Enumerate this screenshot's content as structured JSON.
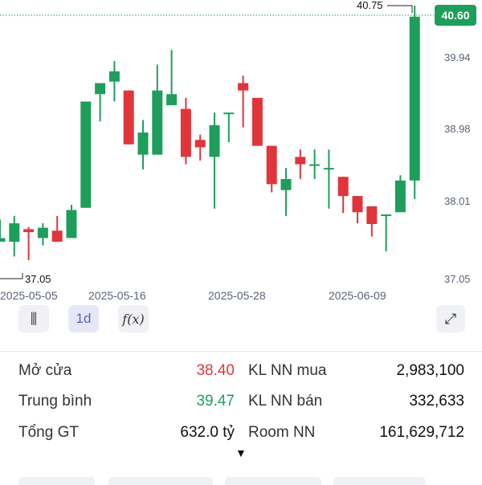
{
  "colors": {
    "up": "#1e9e5c",
    "down": "#e0353b",
    "axis_text": "#5a6275",
    "current_badge": "#1e9e5c"
  },
  "chart_data": {
    "type": "candlestick",
    "price_labels": [
      "39.94",
      "38.98",
      "38.01",
      "37.05"
    ],
    "price_ticks": [
      39.94,
      38.98,
      38.01,
      37.05
    ],
    "date_labels": [
      "2025-05-05",
      "2025-05-16",
      "2025-05-28",
      "2025-06-09"
    ],
    "high_marker": "40.75",
    "low_marker": "37.05",
    "current_price": "40.60",
    "ylim": [
      37.05,
      40.75
    ],
    "candles": [
      {
        "o": 37.55,
        "h": 37.85,
        "l": 37.55,
        "c": 37.6
      },
      {
        "o": 37.55,
        "h": 37.9,
        "l": 37.35,
        "c": 37.8
      },
      {
        "o": 37.72,
        "h": 37.75,
        "l": 37.3,
        "c": 37.68
      },
      {
        "o": 37.6,
        "h": 37.8,
        "l": 37.5,
        "c": 37.74
      },
      {
        "o": 37.7,
        "h": 37.9,
        "l": 37.55,
        "c": 37.55
      },
      {
        "o": 37.6,
        "h": 38.05,
        "l": 37.6,
        "c": 37.98
      },
      {
        "o": 38.01,
        "h": 39.45,
        "l": 38.01,
        "c": 39.45
      },
      {
        "o": 39.55,
        "h": 39.7,
        "l": 39.18,
        "c": 39.7
      },
      {
        "o": 39.72,
        "h": 40.0,
        "l": 39.45,
        "c": 39.86
      },
      {
        "o": 39.6,
        "h": 39.6,
        "l": 38.87,
        "c": 38.87
      },
      {
        "o": 38.73,
        "h": 39.2,
        "l": 38.53,
        "c": 39.03
      },
      {
        "o": 38.73,
        "h": 39.95,
        "l": 38.73,
        "c": 39.6
      },
      {
        "o": 39.4,
        "h": 40.15,
        "l": 39.4,
        "c": 39.55
      },
      {
        "o": 39.35,
        "h": 39.5,
        "l": 38.6,
        "c": 38.7
      },
      {
        "o": 38.93,
        "h": 39.0,
        "l": 38.65,
        "c": 38.83
      },
      {
        "o": 38.7,
        "h": 39.3,
        "l": 38.0,
        "c": 39.13
      },
      {
        "o": 39.3,
        "h": 39.3,
        "l": 38.9,
        "c": 39.3
      },
      {
        "o": 39.7,
        "h": 39.8,
        "l": 39.1,
        "c": 39.6
      },
      {
        "o": 39.5,
        "h": 39.5,
        "l": 38.85,
        "c": 38.85
      },
      {
        "o": 38.85,
        "h": 38.85,
        "l": 38.22,
        "c": 38.33
      },
      {
        "o": 38.25,
        "h": 38.55,
        "l": 37.9,
        "c": 38.4
      },
      {
        "o": 38.7,
        "h": 38.8,
        "l": 38.4,
        "c": 38.6
      },
      {
        "o": 38.6,
        "h": 38.8,
        "l": 38.4,
        "c": 38.6
      },
      {
        "o": 38.55,
        "h": 38.8,
        "l": 38.0,
        "c": 38.55
      },
      {
        "o": 38.43,
        "h": 38.43,
        "l": 37.94,
        "c": 38.17
      },
      {
        "o": 38.17,
        "h": 38.17,
        "l": 37.8,
        "c": 37.95
      },
      {
        "o": 38.03,
        "h": 38.03,
        "l": 37.62,
        "c": 37.79
      },
      {
        "o": 37.92,
        "h": 37.92,
        "l": 37.42,
        "c": 37.92
      },
      {
        "o": 37.95,
        "h": 38.45,
        "l": 37.95,
        "c": 38.38
      },
      {
        "o": 38.38,
        "h": 40.75,
        "l": 38.13,
        "c": 40.6
      }
    ]
  },
  "toolbar": {
    "candle_icon_label": "⫼",
    "interval_label": "1d",
    "fx_label": "f(x)",
    "expand_label": "⤢"
  },
  "stats": {
    "open_label": "Mở cửa",
    "open_value": "38.40",
    "avg_label": "Trung bình",
    "avg_value": "39.47",
    "total_label": "Tổng GT",
    "total_value": "632.0 tỷ",
    "foreign_buy_label": "KL NN mua",
    "foreign_buy_value": "2,983,100",
    "foreign_sell_label": "KL NN bán",
    "foreign_sell_value": "332,633",
    "room_label": "Room NN",
    "room_value": "161,629,712"
  },
  "expand_caret": "▼"
}
